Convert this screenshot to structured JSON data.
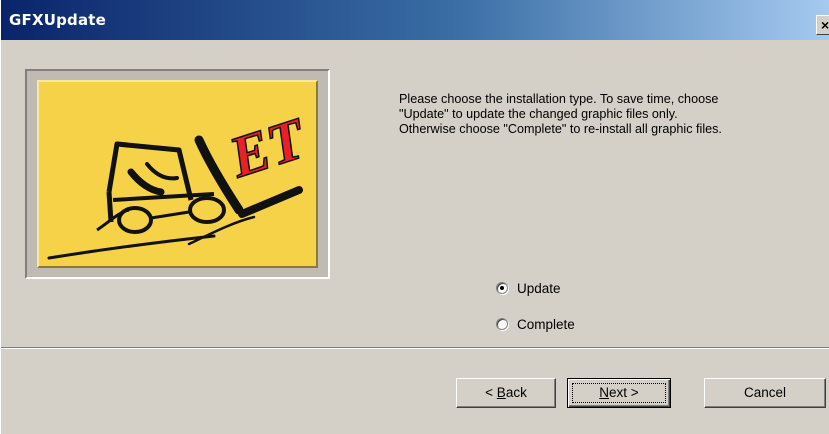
{
  "window": {
    "title": "GFXUpdate",
    "close_glyph": "×"
  },
  "logo": {
    "text": "ET",
    "icon": "forklift-logo"
  },
  "instructions": {
    "line1": "Please choose the installation type. To save time, choose",
    "line2": "\"Update\" to update the changed graphic files only.",
    "line3": "Otherwise choose \"Complete\" to re-install all graphic files."
  },
  "options": [
    {
      "label": "Update",
      "selected": true
    },
    {
      "label": "Complete",
      "selected": false
    }
  ],
  "buttons": {
    "back_prefix": "< ",
    "back_mnemonic": "B",
    "back_rest": "ack",
    "next_mnemonic": "N",
    "next_rest": "ext >",
    "cancel_label": "Cancel"
  },
  "colors": {
    "dialog_bg": "#d4d0c8",
    "title_start": "#0a246a",
    "title_end": "#a6caf0",
    "logo_bg": "#f5d248",
    "logo_accent": "#e8202a"
  }
}
